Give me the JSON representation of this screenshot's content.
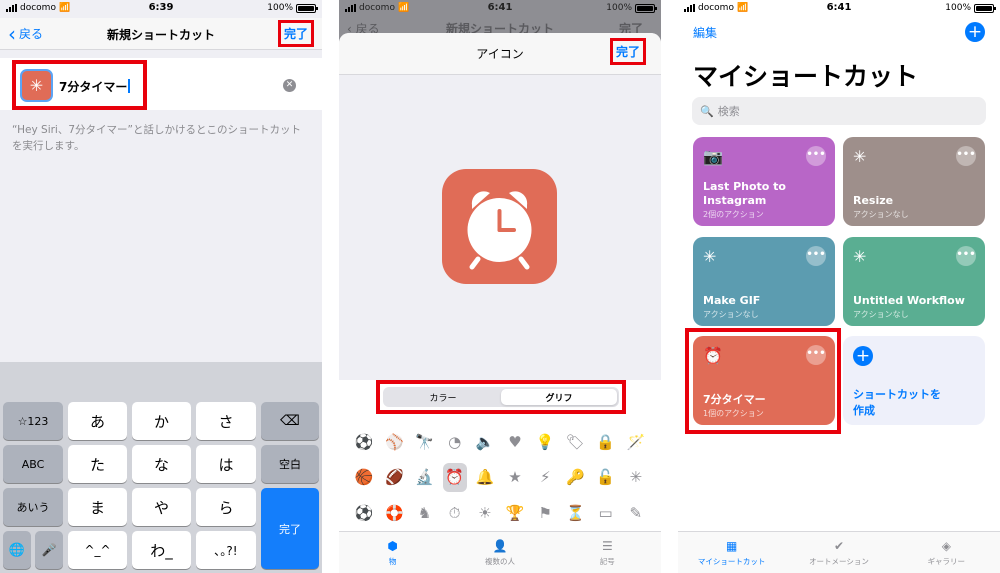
{
  "screen1": {
    "status": {
      "carrier": "docomo",
      "time": "6:39",
      "battery": "100%"
    },
    "nav": {
      "back_label": "戻る",
      "title": "新規ショートカット",
      "done_label": "完了"
    },
    "shortcut_name": "7分タイマー",
    "hint_text": "“Hey Siri、7分タイマー”と話しかけるとこのショートカットを実行します。",
    "keyboard": {
      "row1": [
        "☆123",
        "あ",
        "か",
        "さ",
        "⌫"
      ],
      "row2": [
        "ABC",
        "た",
        "な",
        "は",
        "空白"
      ],
      "row3": [
        "あいう",
        "ま",
        "や",
        "ら",
        "完了"
      ],
      "row4": [
        "🌐",
        "🎤",
        "^_^",
        "わ_",
        "､｡?!"
      ]
    }
  },
  "screen2": {
    "status": {
      "carrier": "docomo",
      "time": "6:41",
      "battery": "100%"
    },
    "behind_back": "戻る",
    "behind_title": "新規ショートカット",
    "behind_done": "完了",
    "title": "アイコン",
    "done_label": "完了",
    "segments": [
      "カラー",
      "グリフ"
    ],
    "selected_segment": "グリフ",
    "icon_color": "#e06c57",
    "glyph_rows": [
      [
        "⚽",
        "⚾",
        "🔭",
        "◔",
        "🔈",
        "♥",
        "💡",
        "🏷",
        "🔒",
        "🪄"
      ],
      [
        "🏀",
        "🏈",
        "🔬",
        "⏰",
        "🔔",
        "★",
        "⚡",
        "🔑",
        "🔓",
        "✳"
      ],
      [
        "⚽",
        "🛟",
        "♞",
        "⏱",
        "☀",
        "🏆",
        "⚑",
        "⏳",
        "▭",
        "✎"
      ]
    ],
    "tabs": [
      {
        "label": "物",
        "icon": "cube-icon"
      },
      {
        "label": "複数の人",
        "icon": "person-icon"
      },
      {
        "label": "記号",
        "icon": "sliders-icon"
      }
    ]
  },
  "screen3": {
    "status": {
      "carrier": "docomo",
      "time": "6:41",
      "battery": "100%"
    },
    "edit_label": "編集",
    "title": "マイショートカット",
    "search_placeholder": "検索",
    "cards": [
      {
        "name": "Last Photo to Instagram",
        "sub": "2個のアクション",
        "color": "#b866c7",
        "icon": "camera-icon"
      },
      {
        "name": "Resize",
        "sub": "アクションなし",
        "color": "#9e8f8b",
        "icon": "sparkle-icon"
      },
      {
        "name": "Make GIF",
        "sub": "アクションなし",
        "color": "#5c9cb0",
        "icon": "sparkle-icon"
      },
      {
        "name": "Untitled Workflow",
        "sub": "アクションなし",
        "color": "#5aae92",
        "icon": "sparkle-icon"
      },
      {
        "name": "7分タイマー",
        "sub": "1個のアクション",
        "color": "#e06c57",
        "icon": "alarm-icon"
      }
    ],
    "new_card_label_1": "ショートカットを",
    "new_card_label_2": "作成",
    "tabs": [
      {
        "label": "マイショートカット",
        "icon": "grid-icon"
      },
      {
        "label": "オートメーション",
        "icon": "check-icon"
      },
      {
        "label": "ギャラリー",
        "icon": "layers-icon"
      }
    ]
  }
}
